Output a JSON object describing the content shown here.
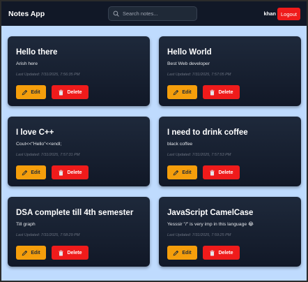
{
  "app": {
    "title": "Notes App"
  },
  "search": {
    "placeholder": "Search notes..."
  },
  "user": {
    "name": "khan",
    "logout_label": "Logout"
  },
  "actions": {
    "edit_label": "Edit",
    "delete_label": "Delete"
  },
  "colors": {
    "page_background": "#bfdbfe",
    "navbar": "#111827",
    "card": "#1e293b",
    "edit_button": "#f59e0b",
    "delete_button": "#ef1b1b"
  },
  "icons": {
    "edit": "pencil-icon",
    "delete": "trash-icon",
    "search": "search-icon"
  },
  "notes": [
    {
      "title": "Hello there",
      "body": "Arish here",
      "updated": "Last Updated: 7/31/2025, 7:56:35 PM"
    },
    {
      "title": "Hello World",
      "body": "Best Web developer",
      "updated": "Last Updated: 7/31/2025, 7:57:05 PM"
    },
    {
      "title": "I love C++",
      "body": "Cout<<\"Hello\"<<endl;",
      "updated": "Last Updated: 7/31/2025, 7:57:31 PM"
    },
    {
      "title": "I need to drink coffee",
      "body": "black coffee",
      "updated": "Last Updated: 7/31/2025, 7:57:53 PM"
    },
    {
      "title": "DSA complete till 4th semester",
      "body": "Till graph",
      "updated": "Last Updated: 7/31/2025, 7:58:29 PM"
    },
    {
      "title": "JavaScript CamelCase",
      "body": "Yesssir \"/\" is very imp in this language 😂",
      "updated": "Last Updated: 7/31/2025, 7:59:25 PM"
    }
  ]
}
